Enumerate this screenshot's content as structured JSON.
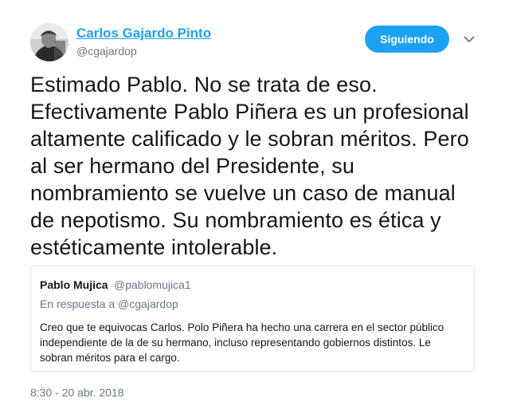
{
  "tweet": {
    "author": {
      "name": "Carlos Gajardo Pinto",
      "handle": "@cgajardop"
    },
    "follow_label": "Siguiendo",
    "text": "Estimado Pablo. No se trata de eso. Efectivamente Pablo Piñera es un profesional altamente calificado y le sobran méritos. Pero al ser hermano del Presidente, su nombramiento se vuelve un caso de manual de nepotismo. Su nombramiento es ética y estéticamente intolerable.",
    "timestamp": "8:30 - 20 abr. 2018"
  },
  "quoted_tweet": {
    "name": "Pablo Mujica",
    "handle": "@pablomujica1",
    "reply_to": "En respuesta a @cgajardop",
    "text": "Creo que te equivocas Carlos. Polo Piñera ha hecho una carrera en el sector público independiente de la de su hermano, incluso representando gobiernos distintos. Le sobran méritos para el cargo."
  },
  "colors": {
    "accent": "#1da1f2",
    "secondary_text": "#657786",
    "border": "#e1e8ed"
  },
  "icons": {
    "caret": "chevron-down-icon"
  }
}
